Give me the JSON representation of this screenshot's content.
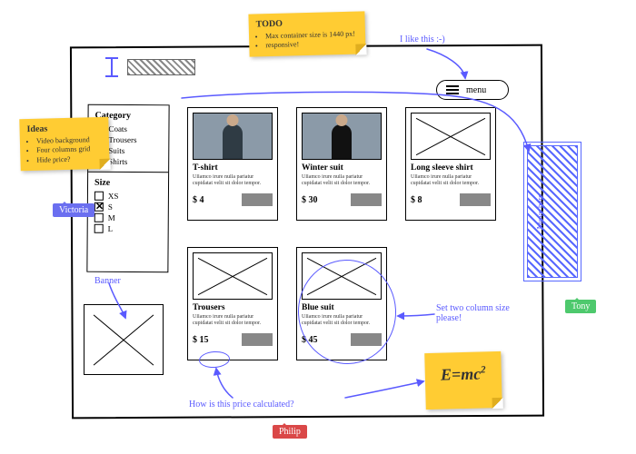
{
  "canvas": {},
  "todo": {
    "title": "TODO",
    "items": [
      "Max container size is 1440 px!",
      "responsive!"
    ]
  },
  "ideas": {
    "title": "Ideas",
    "items": [
      "Video background",
      "Four columns grid",
      "Hide price?"
    ]
  },
  "peers": {
    "victoria": "Victoria",
    "philip": "Philip",
    "tony": "Tony"
  },
  "menu": {
    "label": "menu"
  },
  "filters": {
    "cat_title": "Category",
    "cats": [
      {
        "label": "Coats",
        "checked": false
      },
      {
        "label": "Trousers",
        "checked": true
      },
      {
        "label": "Suits",
        "checked": false
      },
      {
        "label": "Shirts",
        "checked": true
      }
    ],
    "size_title": "Size",
    "sizes": [
      {
        "label": "XS",
        "checked": false
      },
      {
        "label": "S",
        "checked": true
      },
      {
        "label": "M",
        "checked": false
      },
      {
        "label": "L",
        "checked": false
      }
    ]
  },
  "lorem": "Ullamco irure nulla pariatur cupidatat velit sit dolor tempor.",
  "products": [
    {
      "name": "T-shirt",
      "price": "$ 4"
    },
    {
      "name": "Winter suit",
      "price": "$ 30"
    },
    {
      "name": "Long sleeve shirt",
      "price": "$ 8"
    },
    {
      "name": "Trousers",
      "price": "$ 15"
    },
    {
      "name": "Blue suit",
      "price": "$ 45"
    }
  ],
  "annotations": {
    "like": "I like this :-)",
    "banner": "Banner",
    "move": "Move here",
    "twocol": "Set two column size please!",
    "price_q": "How is this price calculated?"
  },
  "formula": {
    "html": "E=mc<sup>2</sup>"
  }
}
